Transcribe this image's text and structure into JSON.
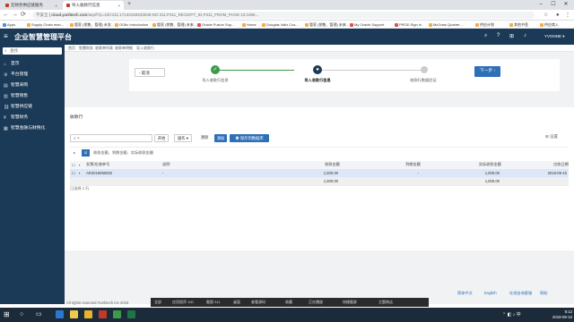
{
  "browser": {
    "tabs": [
      {
        "label": "云财务供应链服务"
      },
      {
        "label": "导入收款行信息"
      }
    ],
    "new_tab": "+",
    "window_controls": {
      "min": "–",
      "max": "☐",
      "close": "✕"
    },
    "url": {
      "security": "不安全",
      "domain": "cloud.yunhtech.com",
      "path": "/aep/f?p=100:311:17133169533938:NO:311:P311_RECEIPT_ID,P311_FROM_PAGE:10:1065..."
    },
    "nav": {
      "back": "←",
      "forward": "→",
      "reload": "⟳"
    }
  },
  "bookmarks": [
    "Apps",
    "Supply Chain man...",
    "管家 (销售、管理) 未发...",
    "OOtic Introduction",
    "管家 (销售、管理) 未来...",
    "Oracle Fusion Sup...",
    "Home",
    "Douglas Vallz Cos...",
    "管家 (销售、管理) 未来...",
    "My Oracle Support",
    "PROD Sign In",
    "McGraw Quarter...",
    "供应计划",
    "其他书签",
    "供应商入"
  ],
  "app": {
    "title": "企业智慧管理平台",
    "user": "YVONNE",
    "header_icons": [
      "search-icon",
      "help-icon",
      "apps-icon",
      "bell-icon"
    ]
  },
  "sidebar": {
    "search_placeholder": "查找",
    "items": [
      {
        "label": "首页",
        "icon": "home-icon"
      },
      {
        "label": "平台管理",
        "icon": "settings-icon"
      },
      {
        "label": "智慧采购",
        "icon": "cart-icon"
      },
      {
        "label": "智慧销售",
        "icon": "sales-icon"
      },
      {
        "label": "智慧供应链",
        "icon": "chain-icon"
      },
      {
        "label": "智慧财务",
        "icon": "finance-icon"
      },
      {
        "label": "智慧金融与财税化",
        "icon": "tax-icon"
      }
    ]
  },
  "breadcrumbs": [
    "首页",
    "智慧财务",
    "收款单列表",
    "收款单明细",
    "导入收款行"
  ],
  "wizard": {
    "back_label": "取消",
    "steps": [
      {
        "label": "导入收款行信息",
        "status": "done"
      },
      {
        "label": "导入收款行信息",
        "status": "current"
      },
      {
        "label": "收款行数据验证",
        "status": "todo"
      }
    ],
    "next_label": "下一步 ›"
  },
  "panel": {
    "title": "收款行",
    "search_go": "开始",
    "actions_label": "操作 ▾",
    "clear_label": "清除",
    "add_label": "添加",
    "save_label": "保存到数据库",
    "settings_label": "设置",
    "filter_note": "收款金额、到期金额、实际收款金额",
    "columns": [
      "发票/应收单号",
      "说明",
      "收款金额",
      "到期金额",
      "实际收款金额",
      "应收日期"
    ],
    "rows": [
      {
        "invoice": "AR2019090002",
        "desc": "",
        "amount": "1,000.00",
        "due": "",
        "actual": "1,000.00",
        "date": "2019-09-10"
      }
    ],
    "totals": {
      "amount": "1,000.00",
      "actual": "1,000.00"
    },
    "pager": "已选择 1 行"
  },
  "footer": {
    "copyright": "All rights reserved.Yunhtech Inc 2016",
    "links": [
      "简体中文",
      "English",
      "在线咨询客服",
      "帮助"
    ]
  },
  "sogou_bar": [
    "全部",
    "应用程序 100",
    "截图 311",
    "桌面",
    "查看源码",
    "收藏",
    "正在播放",
    "快捷截屏",
    "主题商店"
  ],
  "taskbar": {
    "time": "9:12",
    "date": "2019-09-10",
    "colors": {
      "chrome": "#e8b230",
      "excel": "#217346",
      "explorer": "#f2c94c"
    }
  }
}
